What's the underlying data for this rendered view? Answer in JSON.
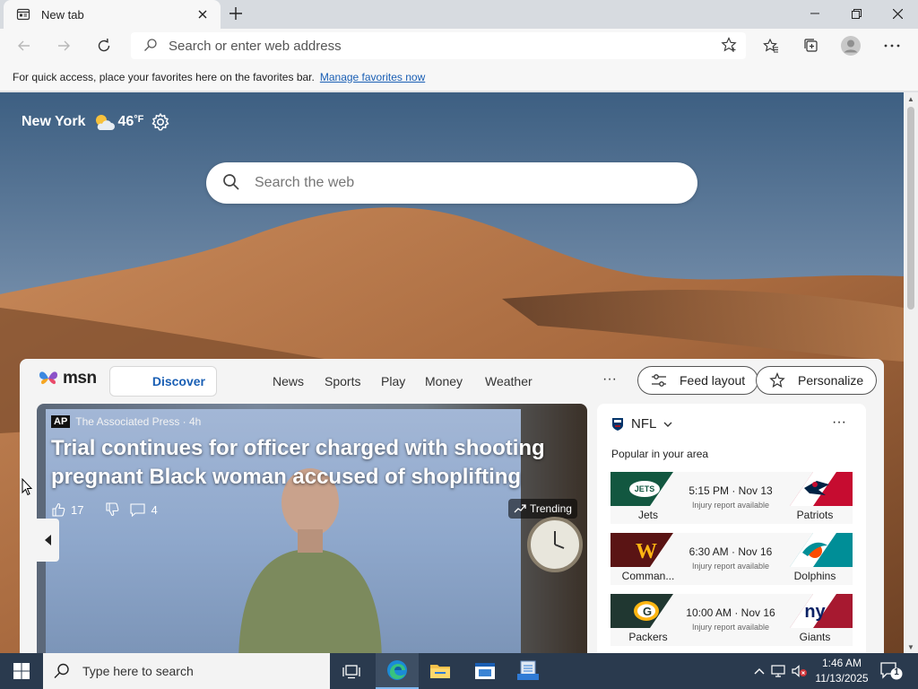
{
  "browser": {
    "tab_title": "New tab",
    "address_placeholder": "Search or enter web address",
    "favbar_text": "For quick access, place your favorites here on the favorites bar.",
    "favbar_link": "Manage favorites now"
  },
  "weather": {
    "city": "New York",
    "temperature": "46",
    "unit": "°F"
  },
  "page_search": {
    "placeholder": "Search the web"
  },
  "feed": {
    "logo": "msn",
    "nav": [
      "Discover",
      "News",
      "Sports",
      "Play",
      "Money",
      "Weather"
    ],
    "more": "···",
    "feed_layout_label": "Feed layout",
    "personalize_label": "Personalize"
  },
  "hero": {
    "source_badge": "AP",
    "source": "The Associated Press · 4h",
    "headline": "Trial continues for officer charged with shooting pregnant Black woman accused of shoplifting",
    "likes": "17",
    "comments": "4",
    "trending": "Trending"
  },
  "nfl": {
    "title": "NFL",
    "subtitle": "Popular in your area",
    "more": "···",
    "games": [
      {
        "home": "Jets",
        "away": "Patriots",
        "time": "5:15 PM · Nov 13",
        "note": "Injury report available",
        "home_color": "#125740",
        "away_color": "#002244",
        "away_accent": "#c60c30"
      },
      {
        "home": "Comman...",
        "away": "Dolphins",
        "time": "6:30 AM · Nov 16",
        "note": "Injury report available",
        "home_color": "#5a1414",
        "away_color": "#008e97",
        "away_accent": "#fc4c02"
      },
      {
        "home": "Packers",
        "away": "Giants",
        "time": "10:00 AM · Nov 16",
        "note": "Injury report available",
        "home_color": "#203731",
        "away_color": "#0b2265",
        "away_accent": "#a71930"
      }
    ]
  },
  "taskbar": {
    "search_placeholder": "Type here to search",
    "time": "1:46 AM",
    "date": "11/13/2025",
    "notification_count": "1"
  },
  "colors": {
    "edge_blue": "#1a5fb4",
    "taskbar": "#2a3a4e"
  }
}
